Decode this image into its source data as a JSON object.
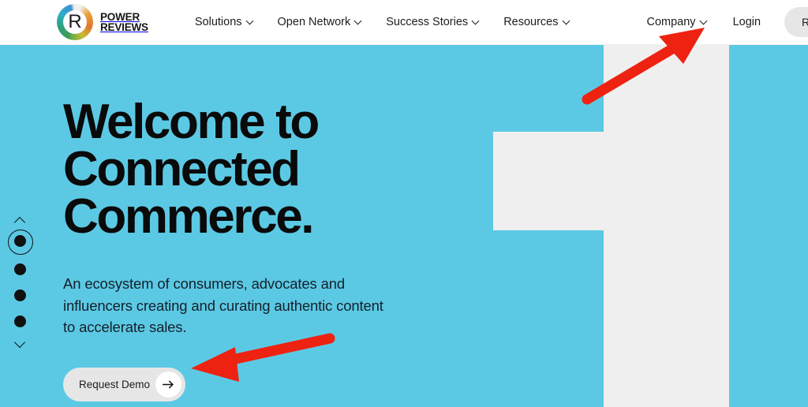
{
  "header": {
    "brand": {
      "logo_icon": "powerreviews-r-logo-icon",
      "wordmark": "POWER\nREVIEWS"
    },
    "primary_nav": [
      {
        "label": "Solutions",
        "has_dropdown": true,
        "icon": "chevron-down-icon"
      },
      {
        "label": "Open Network",
        "has_dropdown": true,
        "icon": "chevron-down-icon"
      },
      {
        "label": "Success Stories",
        "has_dropdown": true,
        "icon": "chevron-down-icon"
      },
      {
        "label": "Resources",
        "has_dropdown": true,
        "icon": "chevron-down-icon"
      }
    ],
    "secondary_nav": [
      {
        "label": "Company",
        "has_dropdown": true,
        "icon": "chevron-down-icon"
      },
      {
        "label": "Login",
        "has_dropdown": false,
        "icon": ""
      }
    ],
    "request_demo_label": "Request Demo"
  },
  "hero": {
    "heading": "Welcome to\nConnected\nCommerce.",
    "subheading": "An ecosystem of consumers, advocates and\ninfluencers creating and curating authentic content\nto accelerate sales.",
    "cta_label": "Request Demo",
    "cta_arrow_icon": "arrow-right-icon",
    "background_graphic": "large-numeral-one",
    "background_color": "#5cc9e4",
    "graphic_color": "#efefef"
  },
  "carousel": {
    "up_icon": "chevron-up-icon",
    "down_icon": "chevron-down-icon",
    "slide_count": 4,
    "active_slide": 1
  },
  "annotations": {
    "color": "#ee2211",
    "arrows": [
      {
        "name": "arrow-pointing-to-header-request-demo",
        "target": "Request Demo"
      },
      {
        "name": "arrow-pointing-to-hero-request-demo",
        "target": "Request Demo"
      }
    ]
  }
}
